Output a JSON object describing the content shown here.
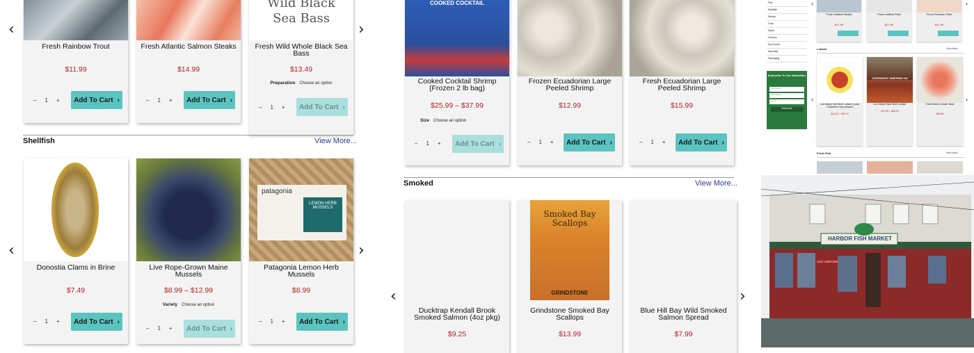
{
  "left": {
    "row1": [
      {
        "title": "Fresh Rainbow Trout",
        "price": "$11.99",
        "qty": "1",
        "btn": "Add To Cart"
      },
      {
        "title": "Fresh Atlantic Salmon Steaks",
        "price": "$14.99",
        "qty": "1",
        "btn": "Add To Cart"
      },
      {
        "title": "Fresh Wild Whole Black Sea Bass",
        "img_text": "Wild Black Sea Bass",
        "price": "$13.49",
        "opt_label": "Preparation",
        "opt_value": "Choose an option",
        "qty": "1",
        "btn": "Add To Cart"
      }
    ],
    "shellfish_title": "Shellfish",
    "shellfish_more": "View More...",
    "row2": [
      {
        "title": "Donostia Clams in Brine",
        "price": "$7.49",
        "qty": "1",
        "btn": "Add To Cart"
      },
      {
        "title": "Live Rope-Grown Maine Mussels",
        "price": "$8.99 – $12.99",
        "opt_label": "Variety",
        "opt_value": "Choose an option",
        "qty": "1",
        "btn": "Add To Cart"
      },
      {
        "title": "Patagonia Lemon Herb Mussels",
        "img_text": "patagonia",
        "img_sub": "LEMON HERB MUSSELS",
        "price": "$8.99",
        "qty": "1",
        "btn": "Add To Cart"
      }
    ]
  },
  "middle": {
    "row1": [
      {
        "title": "Cooked Cocktail Shrimp (Frozen 2 lb bag)",
        "img_text": "COOKED COCKTAIL",
        "price": "$25.99 – $37.99",
        "opt_label": "Size",
        "opt_value": "Choose an option",
        "qty": "1",
        "btn": "Add To Cart"
      },
      {
        "title": "Frozen Ecuadorian Large Peeled Shrimp",
        "price": "$12.99",
        "qty": "1",
        "btn": "Add To Cart"
      },
      {
        "title": "Fresh Ecuadorian Large Peeled Shrimp",
        "price": "$15.99",
        "qty": "1",
        "btn": "Add To Cart"
      }
    ],
    "smoked_title": "Smoked",
    "smoked_more": "View More...",
    "row2": [
      {
        "title": "Ducktrap Kendall Brook Smoked Salmon (4oz pkg)",
        "price": "$9.25"
      },
      {
        "title": "Grindstone Smoked Bay Scallops",
        "img_text": "Smoked Bay Scallops",
        "img_sub": "GRINDSTONE",
        "price": "$13.99"
      },
      {
        "title": "Blue Hill Bay Wild Smoked Salmon Spread",
        "price": "$7.99"
      }
    ]
  },
  "right": {
    "sidebar": [
      "Fish",
      "Shellfish",
      "Shrimp",
      "Crab",
      "Squid",
      "Grocery",
      "Dry Goods",
      "Specialty",
      "Packaging"
    ],
    "newsletter": {
      "title": "Subscribe To Our Newsletter",
      "fields": [
        "First Name",
        "Last Name",
        "Email"
      ],
      "btn": "Subscribe"
    },
    "top_products": [
      {
        "title": "Fresh Halibut Steaks",
        "price": "$17.99"
      },
      {
        "title": "Fresh Halibut Fillet",
        "price": "$21.99"
      },
      {
        "title": "Fresh Flounder Fillet",
        "price": "$11.99"
      }
    ],
    "lobster_title": "Lobster",
    "lobster_more": "View More...",
    "lobster_products": [
      {
        "title": "Live Maine Soft Shell Lobster (Local Customers only, please)",
        "price": "$14.30 – $29.70"
      },
      {
        "title": "Live Maine Hard Shell Lobster",
        "price": "$17.99 – $28.99",
        "img_text": "OVERNIGHT SHIPPING ON"
      },
      {
        "title": "Fresh Maine Lobster Meat",
        "price": "$69.99"
      }
    ],
    "fresh_fish_title": "Fresh Fish",
    "fresh_fish_more": "View More...",
    "store_sign": "HARBOR FISH MARKET",
    "store_small_sign": "LIVE LOBSTERS"
  }
}
